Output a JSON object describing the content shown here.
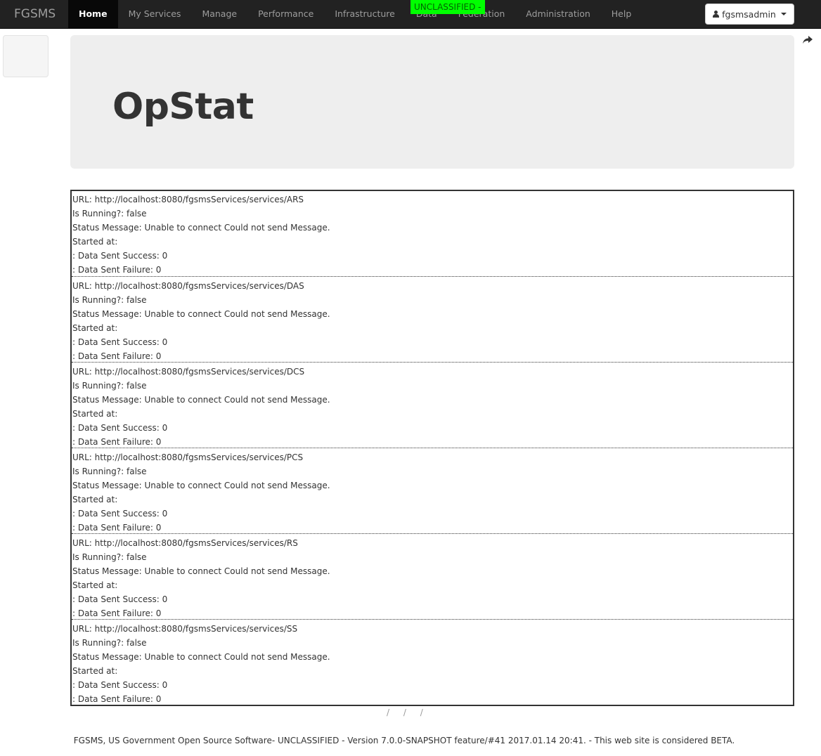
{
  "navbar": {
    "brand": "FGSMS",
    "items": [
      {
        "label": "Home",
        "active": true
      },
      {
        "label": "My Services"
      },
      {
        "label": "Manage"
      },
      {
        "label": "Performance"
      },
      {
        "label": "Infrastructure"
      },
      {
        "label": "Data"
      },
      {
        "label": "Federation"
      },
      {
        "label": "Administration"
      },
      {
        "label": "Help"
      }
    ],
    "classification": "UNCLASSIFIED -",
    "user": "fgsmsadmin"
  },
  "colors": {
    "navbar_bg": "#222222",
    "classification_bg": "#00ff00",
    "jumbotron_bg": "#eeeeee"
  },
  "page": {
    "title": "OpStat"
  },
  "services": [
    {
      "url": "URL: http://localhost:8080/fgsmsServices/services/ARS",
      "running": "Is Running?: false",
      "status": "Status Message: Unable to connect Could not send Message.",
      "started": "Started at:",
      "success": ": Data Sent Success: 0",
      "failure": ": Data Sent Failure: 0"
    },
    {
      "url": "URL: http://localhost:8080/fgsmsServices/services/DAS",
      "running": "Is Running?: false",
      "status": "Status Message: Unable to connect Could not send Message.",
      "started": "Started at:",
      "success": ": Data Sent Success: 0",
      "failure": ": Data Sent Failure: 0"
    },
    {
      "url": "URL: http://localhost:8080/fgsmsServices/services/DCS",
      "running": "Is Running?: false",
      "status": "Status Message: Unable to connect Could not send Message.",
      "started": "Started at:",
      "success": ": Data Sent Success: 0",
      "failure": ": Data Sent Failure: 0"
    },
    {
      "url": "URL: http://localhost:8080/fgsmsServices/services/PCS",
      "running": "Is Running?: false",
      "status": "Status Message: Unable to connect Could not send Message.",
      "started": "Started at:",
      "success": ": Data Sent Success: 0",
      "failure": ": Data Sent Failure: 0"
    },
    {
      "url": "URL: http://localhost:8080/fgsmsServices/services/RS",
      "running": "Is Running?: false",
      "status": "Status Message: Unable to connect Could not send Message.",
      "started": "Started at:",
      "success": ": Data Sent Success: 0",
      "failure": ": Data Sent Failure: 0"
    },
    {
      "url": "URL: http://localhost:8080/fgsmsServices/services/SS",
      "running": "Is Running?: false",
      "status": "Status Message: Unable to connect Could not send Message.",
      "started": "Started at:",
      "success": ": Data Sent Success: 0",
      "failure": ": Data Sent Failure: 0"
    }
  ],
  "misc": {
    "slashes": "/ / /"
  },
  "footer": {
    "text": "FGSMS, US Government Open Source Software- UNCLASSIFIED - Version 7.0.0-SNAPSHOT feature/#41 2017.01.14 20:41. - This web site is considered BETA."
  }
}
